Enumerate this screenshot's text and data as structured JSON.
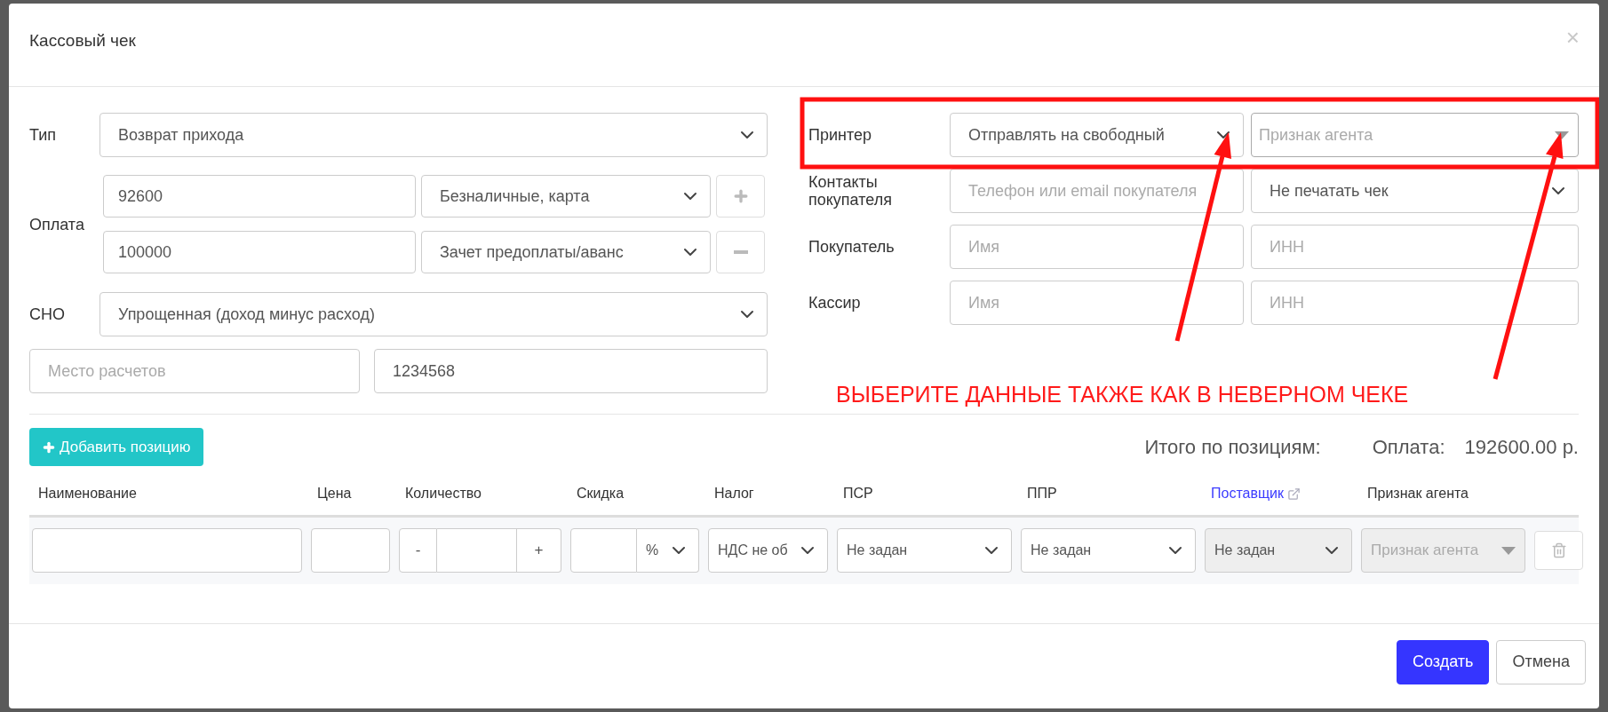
{
  "dialog": {
    "title": "Кассовый чек",
    "close_symbol": "×"
  },
  "left": {
    "type": {
      "label": "Тип",
      "value": "Возврат прихода"
    },
    "payment": {
      "label": "Оплата",
      "rows": [
        {
          "amount": "92600",
          "method": "Безналичные, карта",
          "kind": "add"
        },
        {
          "amount": "100000",
          "method": "Зачет предоплаты/аванс",
          "kind": "remove"
        }
      ]
    },
    "tax_system": {
      "label": "СНО",
      "value": "Упрощенная (доход минус расход)"
    },
    "extra": [
      {
        "placeholder": "Место расчетов"
      },
      {
        "value": "1234568"
      }
    ]
  },
  "right": {
    "rows": [
      {
        "label": "Принтер",
        "fields": [
          {
            "kind": "select",
            "value": "Отправлять на свободный"
          },
          {
            "kind": "combo",
            "placeholder": "Признак агента"
          }
        ]
      },
      {
        "label": "Контакты покупателя",
        "fields": [
          {
            "kind": "input",
            "placeholder": "Телефон или email покупателя"
          },
          {
            "kind": "select",
            "value": "Не печатать чек"
          }
        ]
      },
      {
        "label": "Покупатель",
        "fields": [
          {
            "kind": "input",
            "placeholder": "Имя"
          },
          {
            "kind": "input",
            "placeholder": "ИНН"
          }
        ]
      },
      {
        "label": "Кассир",
        "fields": [
          {
            "kind": "input",
            "placeholder": "Имя"
          },
          {
            "kind": "input",
            "placeholder": "ИНН"
          }
        ]
      }
    ]
  },
  "annotation": {
    "text": "ВЫБЕРИТЕ ДАННЫЕ ТАКЖЕ КАК В НЕВЕРНОМ ЧЕКЕ"
  },
  "items": {
    "add_button": "Добавить позицию",
    "totals_label": "Итого по позициям:",
    "payment_label": "Оплата:",
    "payment_total": "192600.00 р.",
    "columns": [
      {
        "label": "Наименование",
        "kind": "text"
      },
      {
        "label": "Цена",
        "kind": "text"
      },
      {
        "label": "Количество",
        "kind": "text"
      },
      {
        "label": "Скидка",
        "kind": "text"
      },
      {
        "label": "Налог",
        "kind": "text"
      },
      {
        "label": "ПСР",
        "kind": "text"
      },
      {
        "label": "ППР",
        "kind": "text"
      },
      {
        "label": "Поставщик",
        "kind": "link"
      },
      {
        "label": "Признак агента",
        "kind": "text"
      }
    ],
    "rows": [
      {
        "cells": [
          {
            "kind": "input"
          },
          {
            "kind": "input"
          },
          {
            "kind": "stepper",
            "minus": "-",
            "plus": "+"
          },
          {
            "kind": "discount",
            "unit": "%"
          },
          {
            "kind": "select",
            "value": "НДС не об",
            "disabled": false
          },
          {
            "kind": "select",
            "value": "Не задан",
            "disabled": false
          },
          {
            "kind": "select",
            "value": "Не задан",
            "disabled": false
          },
          {
            "kind": "select",
            "value": "Не задан",
            "disabled": true
          },
          {
            "kind": "combo",
            "placeholder": "Признак агента",
            "disabled": true
          },
          {
            "kind": "delete"
          }
        ]
      }
    ]
  },
  "footer": {
    "buttons": [
      {
        "label": "Создать",
        "kind": "primary"
      },
      {
        "label": "Отмена",
        "kind": "default"
      }
    ]
  }
}
